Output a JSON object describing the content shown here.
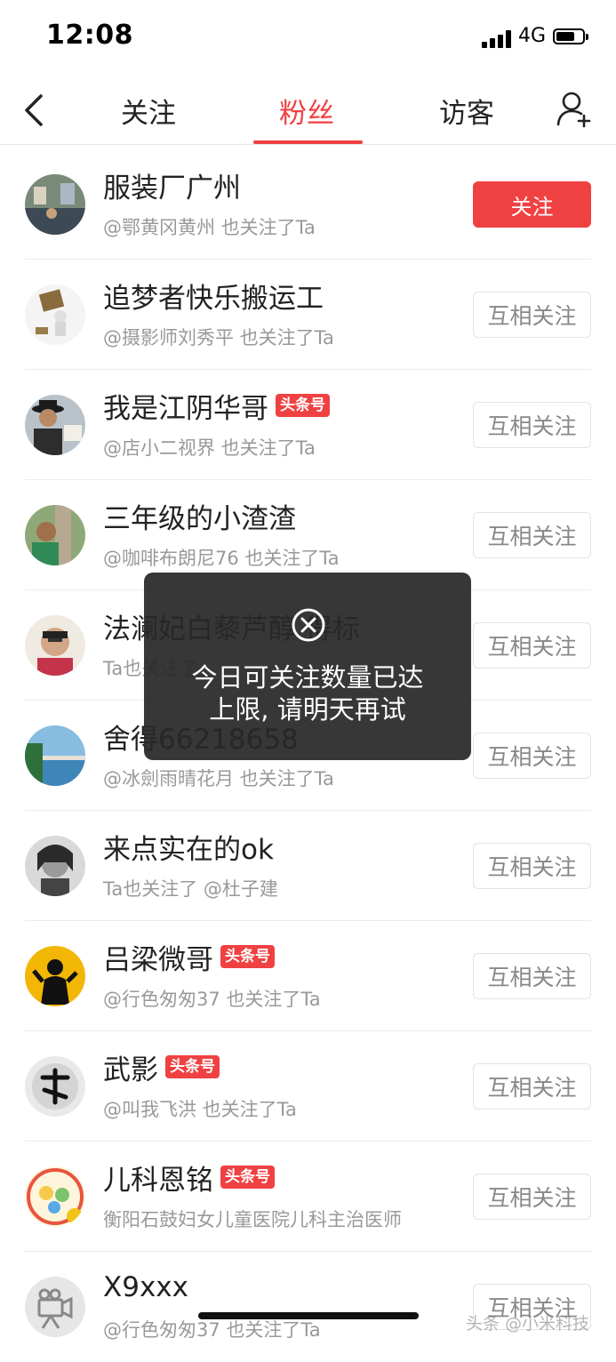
{
  "status_bar": {
    "time": "12:08",
    "network": "4G",
    "battery_level": 0.7
  },
  "nav": {
    "tabs": [
      {
        "label": "关注",
        "active": false
      },
      {
        "label": "粉丝",
        "active": true
      },
      {
        "label": "访客",
        "active": false
      }
    ],
    "back_icon": "chevron-left-icon",
    "add_user_icon": "add-user-icon"
  },
  "accent_color": "#f04142",
  "users": [
    {
      "name": "服装厂广州",
      "badge": "",
      "subtitle": "@鄂黄冈黄州 也关注了Ta",
      "button": "关注",
      "button_style": "primary"
    },
    {
      "name": "追梦者快乐搬运工",
      "badge": "",
      "subtitle": "@摄影师刘秀平 也关注了Ta",
      "button": "互相关注",
      "button_style": "outline"
    },
    {
      "name": "我是江阴华哥",
      "badge": "头条号",
      "subtitle": "@店小二视界 也关注了Ta",
      "button": "互相关注",
      "button_style": "outline"
    },
    {
      "name": "三年级的小渣渣",
      "badge": "",
      "subtitle": "@咖啡布朗尼76 也关注了Ta",
      "button": "互相关注",
      "button_style": "outline"
    },
    {
      "name": "法澜妃白藜芦醇 得标",
      "badge": "",
      "subtitle": "Ta也关注了 ",
      "button": "互相关注",
      "button_style": "outline"
    },
    {
      "name": "舍得66218658",
      "badge": "",
      "subtitle": "@冰劍雨晴花月 也关注了Ta",
      "button": "互相关注",
      "button_style": "outline"
    },
    {
      "name": "来点实在的ok",
      "badge": "",
      "subtitle": "Ta也关注了 @杜子建",
      "button": "互相关注",
      "button_style": "outline"
    },
    {
      "name": "吕梁微哥",
      "badge": "头条号",
      "subtitle": "@行色匆匆37 也关注了Ta",
      "button": "互相关注",
      "button_style": "outline"
    },
    {
      "name": "武影",
      "badge": "头条号",
      "subtitle": "@叫我飞洪 也关注了Ta",
      "button": "互相关注",
      "button_style": "outline"
    },
    {
      "name": "儿科恩铭",
      "badge": "头条号",
      "subtitle": "衡阳石鼓妇女儿童医院儿科主治医师",
      "button": "互相关注",
      "button_style": "outline"
    },
    {
      "name": "X9xxx",
      "badge": "",
      "subtitle": "@行色匆匆37 也关注了Ta",
      "button": "互相关注",
      "button_style": "outline"
    }
  ],
  "toast": {
    "icon": "close-circle-icon",
    "line1": "今日可关注数量已达",
    "line2": "上限, 请明天再试"
  },
  "watermark": "头条 @小米科技"
}
